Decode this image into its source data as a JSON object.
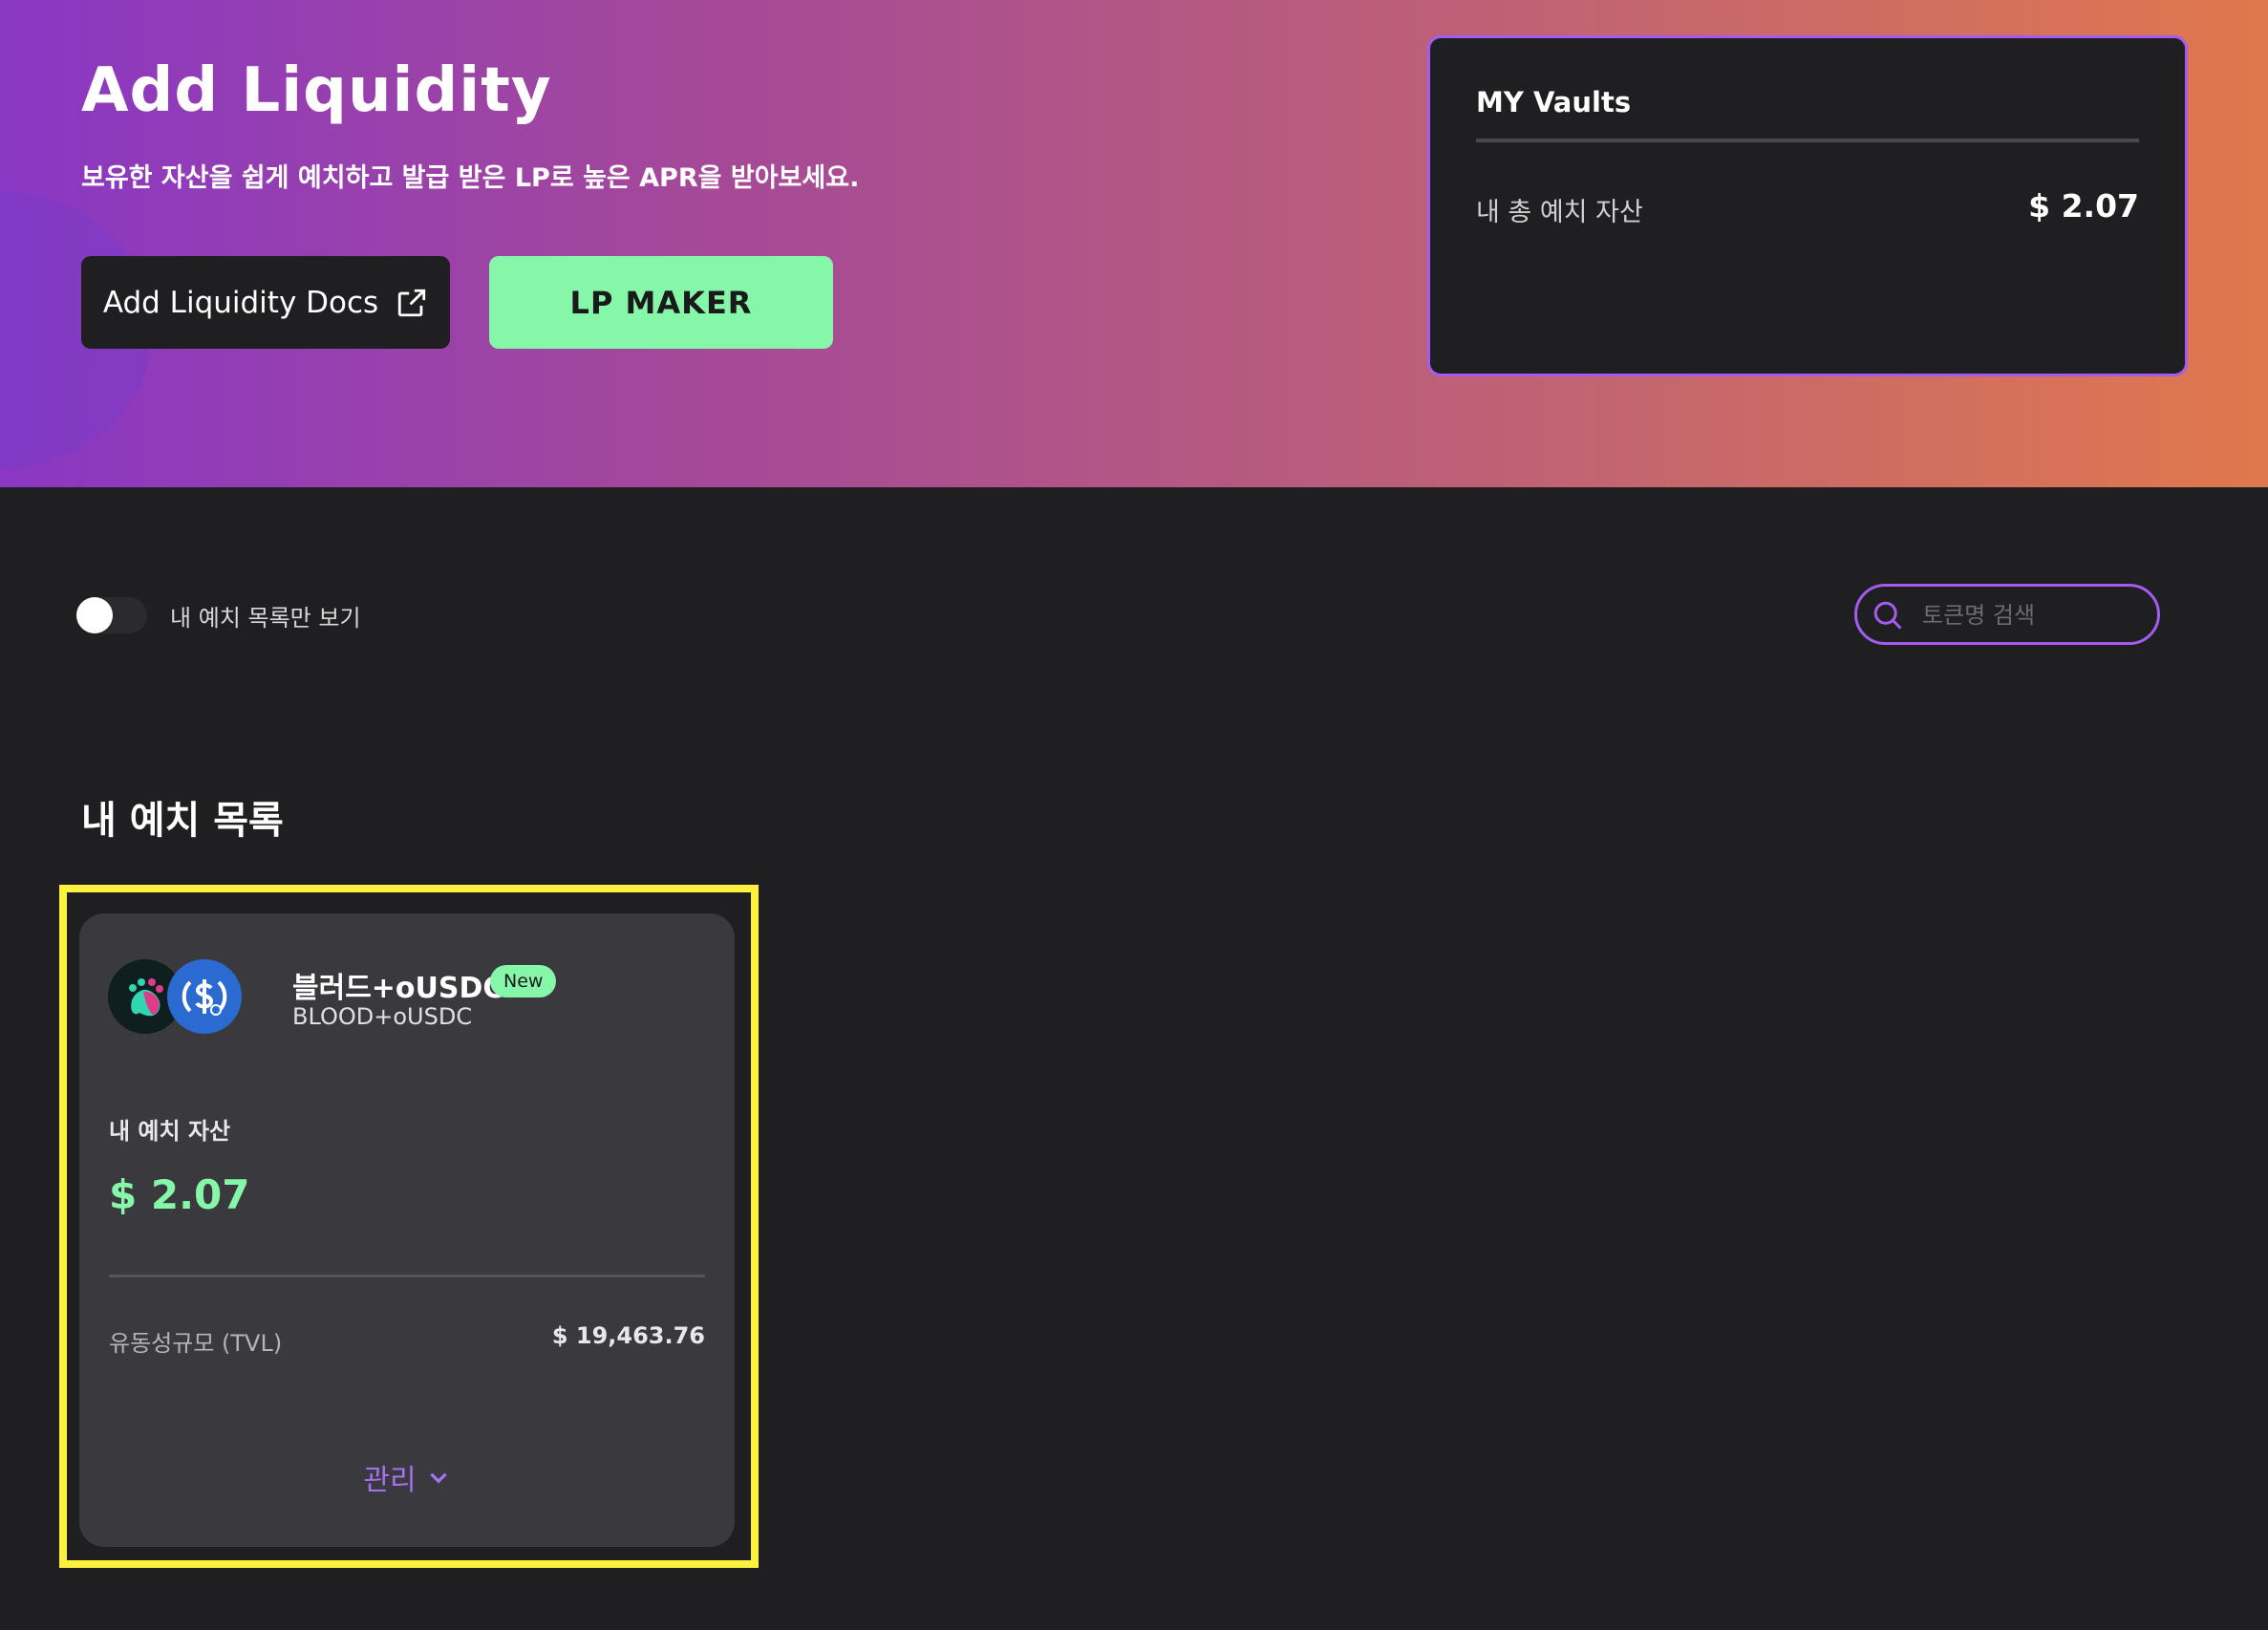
{
  "hero": {
    "title": "Add Liquidity",
    "subtitle": "보유한 자산을 쉽게 예치하고 발급 받은 LP로 높은 APR을 받아보세요.",
    "docs_button": "Add Liquidity Docs",
    "docs_icon": "external-link-icon",
    "lp_button": "LP MAKER"
  },
  "vaults": {
    "title": "MY Vaults",
    "total_label": "내 총 예치 자산",
    "total_value": "$ 2.07"
  },
  "filter": {
    "toggle_label": "내 예치 목록만 보기",
    "toggle_on": false,
    "search_icon": "search-icon",
    "search_placeholder": "토큰명 검색",
    "search_value": ""
  },
  "section": {
    "title": "내 예치 목록"
  },
  "pool": {
    "name": "블러드+oUSDC",
    "badge": "New",
    "symbol": "BLOOD+oUSDC",
    "token_icons": [
      "blood-token-icon",
      "usdc-token-icon"
    ],
    "deposit_label": "내 예치 자산",
    "deposit_value": "$ 2.07",
    "tvl_label": "유동성규모 (TVL)",
    "tvl_value": "$ 19,463.76",
    "manage_label": "관리",
    "manage_icon": "chevron-down-icon"
  },
  "colors": {
    "accent_green": "#86f6a9",
    "accent_purple": "#a45cf0",
    "highlight": "#fdf140",
    "background": "#1f1f21"
  }
}
